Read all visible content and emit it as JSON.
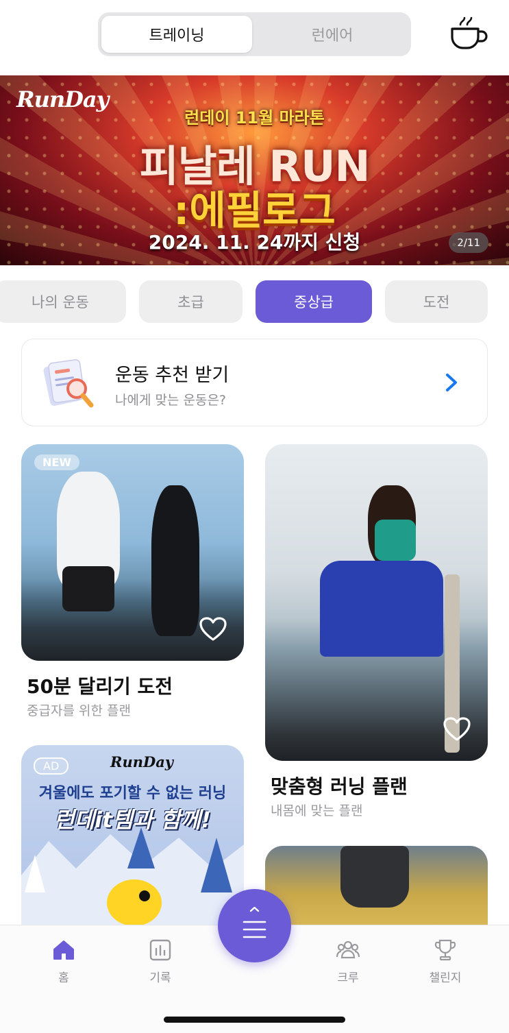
{
  "top_segment": {
    "tabs": [
      {
        "label": "트레이닝",
        "active": true
      },
      {
        "label": "런에어",
        "active": false
      }
    ],
    "right_icon": "coffee-cup-icon"
  },
  "banner": {
    "logo_text": "RunDay",
    "subtitle": "런데이 11월 마라톤",
    "title_line1": "피날레 RUN",
    "title_line2": ":에필로그",
    "date_text": "2024. 11. 24까지 신청",
    "page_indicator": "2/11"
  },
  "filter_chips": [
    {
      "label": "나의 운동",
      "active": false
    },
    {
      "label": "초급",
      "active": false
    },
    {
      "label": "중상급",
      "active": true
    },
    {
      "label": "도전",
      "active": false
    }
  ],
  "recommendation": {
    "title": "운동 추천 받기",
    "subtitle": "나에게 맞는 운동은?",
    "icon": "document-search-icon",
    "action_icon": "chevron-right-icon"
  },
  "cards": [
    {
      "badge": "NEW",
      "title": "50분 달리기 도전",
      "subtitle": "중급자를 위한 플랜"
    },
    {
      "title": "맞춤형 러닝 플랜",
      "subtitle": "내몸에 맞는 플랜"
    }
  ],
  "ad_card": {
    "badge": "AD",
    "logo_text": "RunDay",
    "line1": "겨울에도 포기할 수 없는 러닝",
    "line2": "런데it템과 함께!"
  },
  "bottom_nav": {
    "items": [
      {
        "label": "홈",
        "icon": "home-icon",
        "active": true
      },
      {
        "label": "기록",
        "icon": "chart-icon",
        "active": false
      },
      {
        "label": "크루",
        "icon": "group-icon",
        "active": false
      },
      {
        "label": "챌린지",
        "icon": "trophy-icon",
        "active": false
      }
    ],
    "fab_icon": "menu-expand-icon"
  },
  "colors": {
    "accent": "#6b5bd6",
    "chevron": "#1877f2"
  }
}
